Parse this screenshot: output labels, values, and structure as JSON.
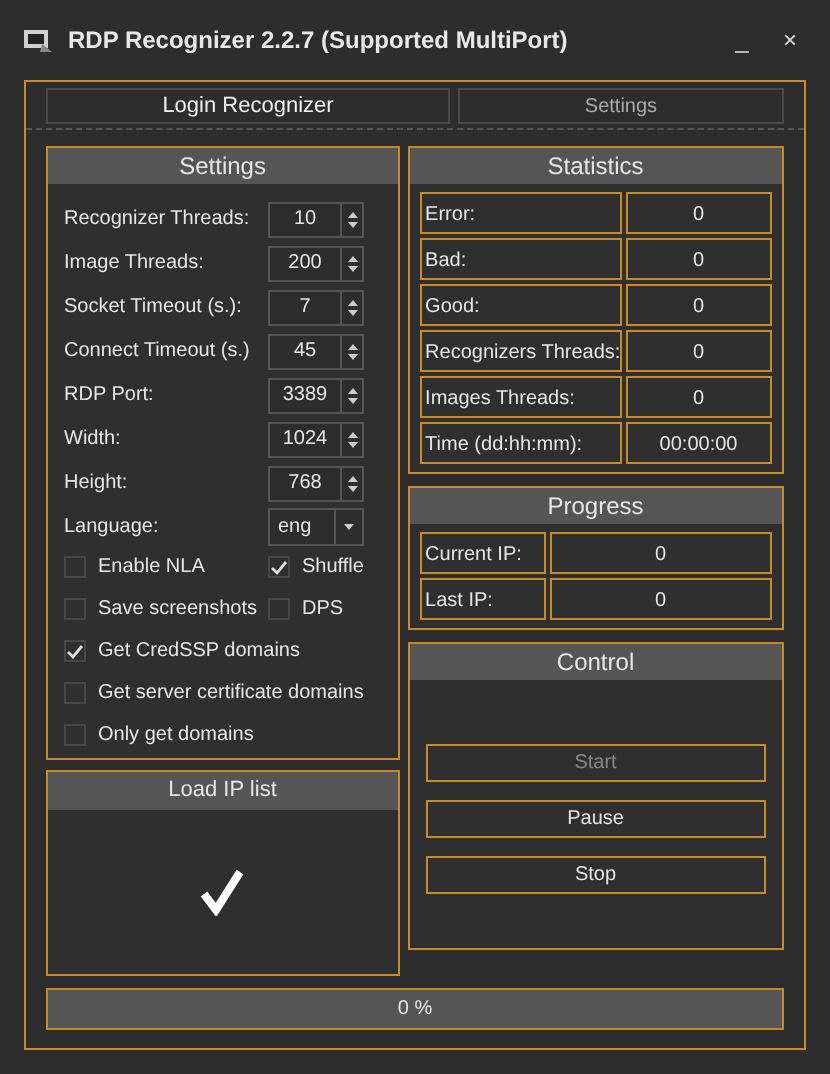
{
  "window": {
    "title": "RDP Recognizer 2.2.7 (Supported MultiPort)",
    "controls": [
      "_",
      "×"
    ]
  },
  "tabs": [
    {
      "label": "Login Recognizer",
      "selected": true
    },
    {
      "label": "Settings",
      "selected": false
    }
  ],
  "settings": {
    "title": "Settings",
    "fields": [
      {
        "kind": "spinner",
        "label": "Recognizer Threads:",
        "value": "10"
      },
      {
        "kind": "spinner",
        "label": "Image Threads:",
        "value": "200"
      },
      {
        "kind": "spinner",
        "label": "Socket Timeout (s.):",
        "value": "7"
      },
      {
        "kind": "spinner",
        "label": "Connect Timeout (s.)",
        "value": "45"
      },
      {
        "kind": "spinner",
        "label": "RDP Port:",
        "value": "3389"
      },
      {
        "kind": "spinner",
        "label": "Width:",
        "value": "1024"
      },
      {
        "kind": "spinner",
        "label": "Height:",
        "value": "768"
      },
      {
        "kind": "dropdown",
        "label": "Language:",
        "value": "eng"
      }
    ],
    "checkbox_rows": [
      [
        {
          "label": "Enable NLA",
          "checked": false
        },
        {
          "label": "Shuffle",
          "checked": true
        }
      ],
      [
        {
          "label": "Save screenshots",
          "checked": false
        },
        {
          "label": "DPS",
          "checked": false
        }
      ],
      [
        {
          "label": "Get CredSSP domains",
          "checked": true
        }
      ],
      [
        {
          "label": "Get server certificate domains",
          "checked": false
        }
      ],
      [
        {
          "label": "Only get domains",
          "checked": false
        }
      ]
    ]
  },
  "load_ip_list": {
    "title": "Load IP list",
    "loaded": true
  },
  "statistics": {
    "title": "Statistics",
    "rows": [
      {
        "label": "Error:",
        "value": "0"
      },
      {
        "label": "Bad:",
        "value": "0"
      },
      {
        "label": "Good:",
        "value": "0"
      },
      {
        "label": "Recognizers Threads:",
        "value": "0"
      },
      {
        "label": "Images Threads:",
        "value": "0"
      },
      {
        "label": "Time (dd:hh:mm):",
        "value": "00:00:00"
      }
    ]
  },
  "progress": {
    "title": "Progress",
    "rows": [
      {
        "label": "Current IP:",
        "value": "0"
      },
      {
        "label": "Last IP:",
        "value": "0"
      }
    ]
  },
  "control": {
    "title": "Control",
    "buttons": [
      {
        "label": "Start",
        "disabled": true
      },
      {
        "label": "Pause",
        "disabled": false
      },
      {
        "label": "Stop",
        "disabled": false
      }
    ]
  },
  "progress_bar": {
    "label": "0 %",
    "level": 0
  }
}
